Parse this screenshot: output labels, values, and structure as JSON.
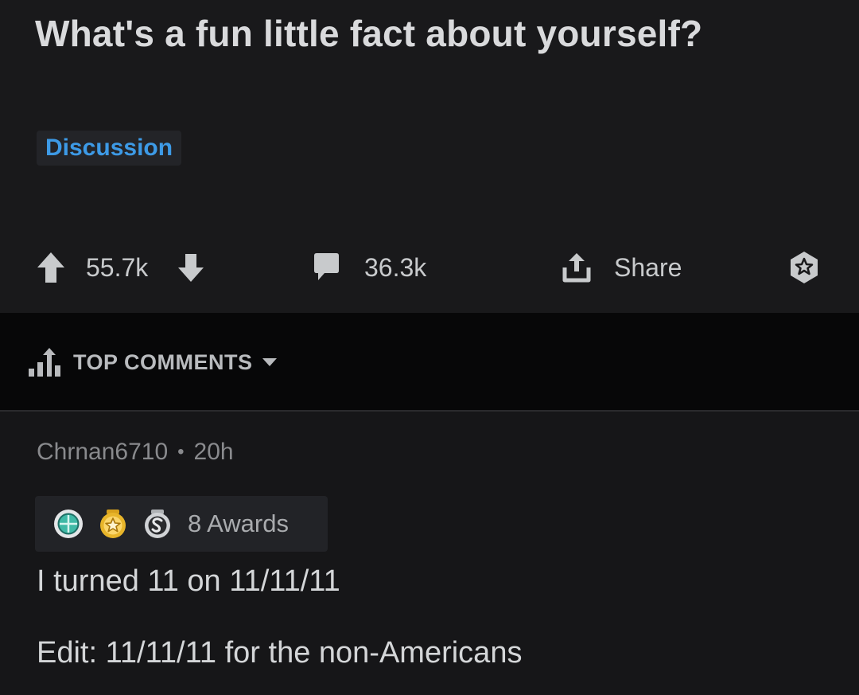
{
  "post": {
    "title": "What's a fun little fact about yourself?",
    "flair": "Discussion",
    "upvotes": "55.7k",
    "comments": "36.3k",
    "share_label": "Share"
  },
  "sort": {
    "label": "TOP COMMENTS"
  },
  "comment": {
    "author": "Chrnan6710",
    "separator": "•",
    "age": "20h",
    "awards_label": "8 Awards",
    "body": [
      "I turned 11 on 11/11/11",
      "Edit: 11/11/11 for the non-Americans"
    ]
  },
  "colors": {
    "background": "#161618",
    "flair_text": "#3d9ae6",
    "sort_bar": "#070708"
  },
  "icons": [
    "upvote-icon",
    "downvote-icon",
    "comment-icon",
    "share-icon",
    "award-icon",
    "sort-bars-icon",
    "caret-down-icon",
    "platinum-award-icon",
    "gold-award-icon",
    "silver-award-icon"
  ]
}
